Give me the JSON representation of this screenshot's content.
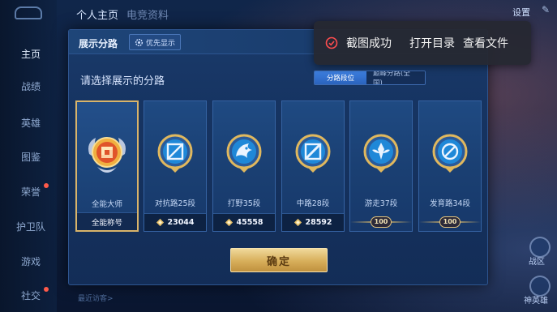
{
  "background": {
    "nav": {
      "items": [
        {
          "label": "主页",
          "active": true
        },
        {
          "label": "战绩",
          "active": false
        },
        {
          "label": "英雄",
          "active": false
        },
        {
          "label": "图鉴",
          "active": false
        },
        {
          "label": "荣誉",
          "active": false
        },
        {
          "label": "护卫队",
          "active": false
        },
        {
          "label": "游戏",
          "active": false
        },
        {
          "label": "社交",
          "active": false
        }
      ]
    },
    "top_tabs": [
      "个人主页",
      "电竞资料"
    ],
    "top_right_label": "设置",
    "side_labels": [
      "战区",
      "神英雄"
    ],
    "bottom_hint": "最近访客>"
  },
  "dialog": {
    "title": "展示分路",
    "priority_label": "优先显示",
    "prompt": "请选择展示的分路",
    "toggle": {
      "active": "分路段位",
      "inactive": "巅峰分路(全国)"
    },
    "cards": [
      {
        "name": "全能大师",
        "footer": "全能称号",
        "type": "title",
        "selected": true,
        "emblem": "master-emblem"
      },
      {
        "name": "对抗路25段",
        "footer": "23044",
        "type": "score",
        "selected": false,
        "emblem": "clash-lane-emblem"
      },
      {
        "name": "打野35段",
        "footer": "45558",
        "type": "score",
        "selected": false,
        "emblem": "jungle-emblem"
      },
      {
        "name": "中路28段",
        "footer": "28592",
        "type": "score",
        "selected": false,
        "emblem": "mid-lane-emblem"
      },
      {
        "name": "游走37段",
        "footer": "100",
        "type": "badge",
        "selected": false,
        "emblem": "roam-emblem"
      },
      {
        "name": "发育路34段",
        "footer": "100",
        "type": "badge",
        "selected": false,
        "emblem": "farm-lane-emblem"
      }
    ],
    "confirm_label": "确定"
  },
  "toast": {
    "message": "截图成功",
    "open_dir": "打开目录",
    "view_file": "查看文件"
  },
  "colors": {
    "accent_blue": "#2a63bd",
    "gold": "#d7ae5a",
    "toast_bg": "#26283a",
    "success_red": "#ff4d4f"
  }
}
